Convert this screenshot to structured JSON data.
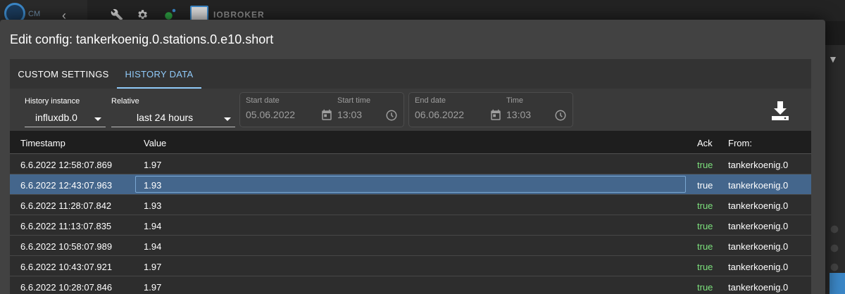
{
  "app": {
    "left_text": "CM",
    "brand": "IOBROKER"
  },
  "dialog": {
    "title": "Edit config: tankerkoenig.0.stations.0.e10.short"
  },
  "tabs": [
    {
      "label": "CUSTOM SETTINGS",
      "active": false
    },
    {
      "label": "HISTORY DATA",
      "active": true
    }
  ],
  "toolbar": {
    "history_instance": {
      "label": "History instance",
      "value": "influxdb.0"
    },
    "relative": {
      "label": "Relative",
      "value": "last 24 hours"
    },
    "start_date": {
      "label": "Start date",
      "value": "05.06.2022"
    },
    "start_time": {
      "label": "Start time",
      "value": "13:03"
    },
    "end_date": {
      "label": "End date",
      "value": "06.06.2022"
    },
    "end_time": {
      "label": "Time",
      "value": "13:03"
    }
  },
  "table": {
    "columns": {
      "timestamp": "Timestamp",
      "value": "Value",
      "ack": "Ack",
      "from": "From:"
    },
    "rows": [
      {
        "timestamp": "6.6.2022 12:58:07.869",
        "value": "1.97",
        "ack": "true",
        "from": "tankerkoenig.0",
        "selected": false
      },
      {
        "timestamp": "6.6.2022 12:43:07.963",
        "value": "1.93",
        "ack": "true",
        "from": "tankerkoenig.0",
        "selected": true
      },
      {
        "timestamp": "6.6.2022 11:28:07.842",
        "value": "1.93",
        "ack": "true",
        "from": "tankerkoenig.0",
        "selected": false
      },
      {
        "timestamp": "6.6.2022 11:13:07.835",
        "value": "1.94",
        "ack": "true",
        "from": "tankerkoenig.0",
        "selected": false
      },
      {
        "timestamp": "6.6.2022 10:58:07.989",
        "value": "1.94",
        "ack": "true",
        "from": "tankerkoenig.0",
        "selected": false
      },
      {
        "timestamp": "6.6.2022 10:43:07.921",
        "value": "1.97",
        "ack": "true",
        "from": "tankerkoenig.0",
        "selected": false
      },
      {
        "timestamp": "6.6.2022 10:28:07.846",
        "value": "1.97",
        "ack": "true",
        "from": "tankerkoenig.0",
        "selected": false
      }
    ]
  },
  "colors": {
    "accent": "#90caf9",
    "selected_row": "#44668c",
    "ack_true": "#7ce07c"
  },
  "icons": {
    "calendar": "calendar-icon",
    "clock": "clock-icon",
    "download": "download-icon",
    "dropdown": "chevron-down-icon"
  }
}
